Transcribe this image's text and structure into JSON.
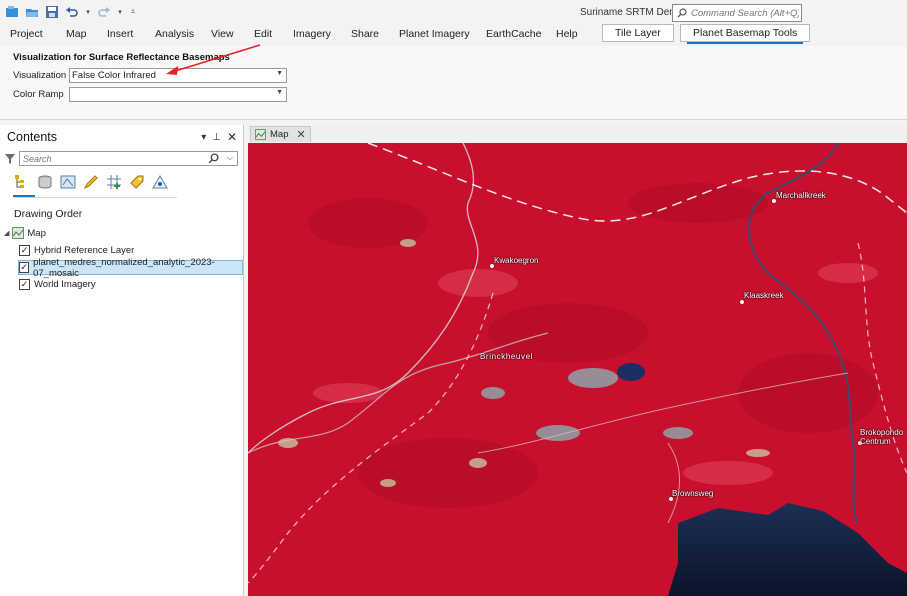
{
  "titlebar": {
    "doc_title": "Suriname SRTM Dem",
    "command_search_placeholder": "Command Search (Alt+Q)"
  },
  "ribbon_tabs": [
    "Project",
    "Map",
    "Insert",
    "Analysis",
    "View",
    "Edit",
    "Imagery",
    "Share",
    "Planet Imagery",
    "EarthCache",
    "Help",
    "Tile Layer",
    "Planet Basemap Tools"
  ],
  "ribbon": {
    "group_title": "Visualization for Surface Reflectance Basemaps",
    "visualization_label": "Visualization",
    "visualization_value": "False Color Infrared",
    "color_ramp_label": "Color Ramp",
    "color_ramp_value": ""
  },
  "contents": {
    "title": "Contents",
    "search_placeholder": "Search",
    "drawing_order": "Drawing Order",
    "map_node": "Map",
    "layers": [
      {
        "name": "Hybrid Reference Layer",
        "checked": true
      },
      {
        "name": "planet_medres_normalized_analytic_2023-07_mosaic",
        "checked": true
      },
      {
        "name": "World Imagery",
        "checked": true
      }
    ]
  },
  "map": {
    "tab_label": "Map",
    "places": [
      "Marchallkreek",
      "Kwakoegron",
      "Klaaskreek",
      "Brinckheuvel",
      "Brokopondo Centrum",
      "Brownsweg"
    ],
    "colors": {
      "vegetation_red": "#c8102e",
      "water": "#0b1a33",
      "accent_blue": "#1a73c8",
      "annotation_red": "#e8202a"
    }
  }
}
